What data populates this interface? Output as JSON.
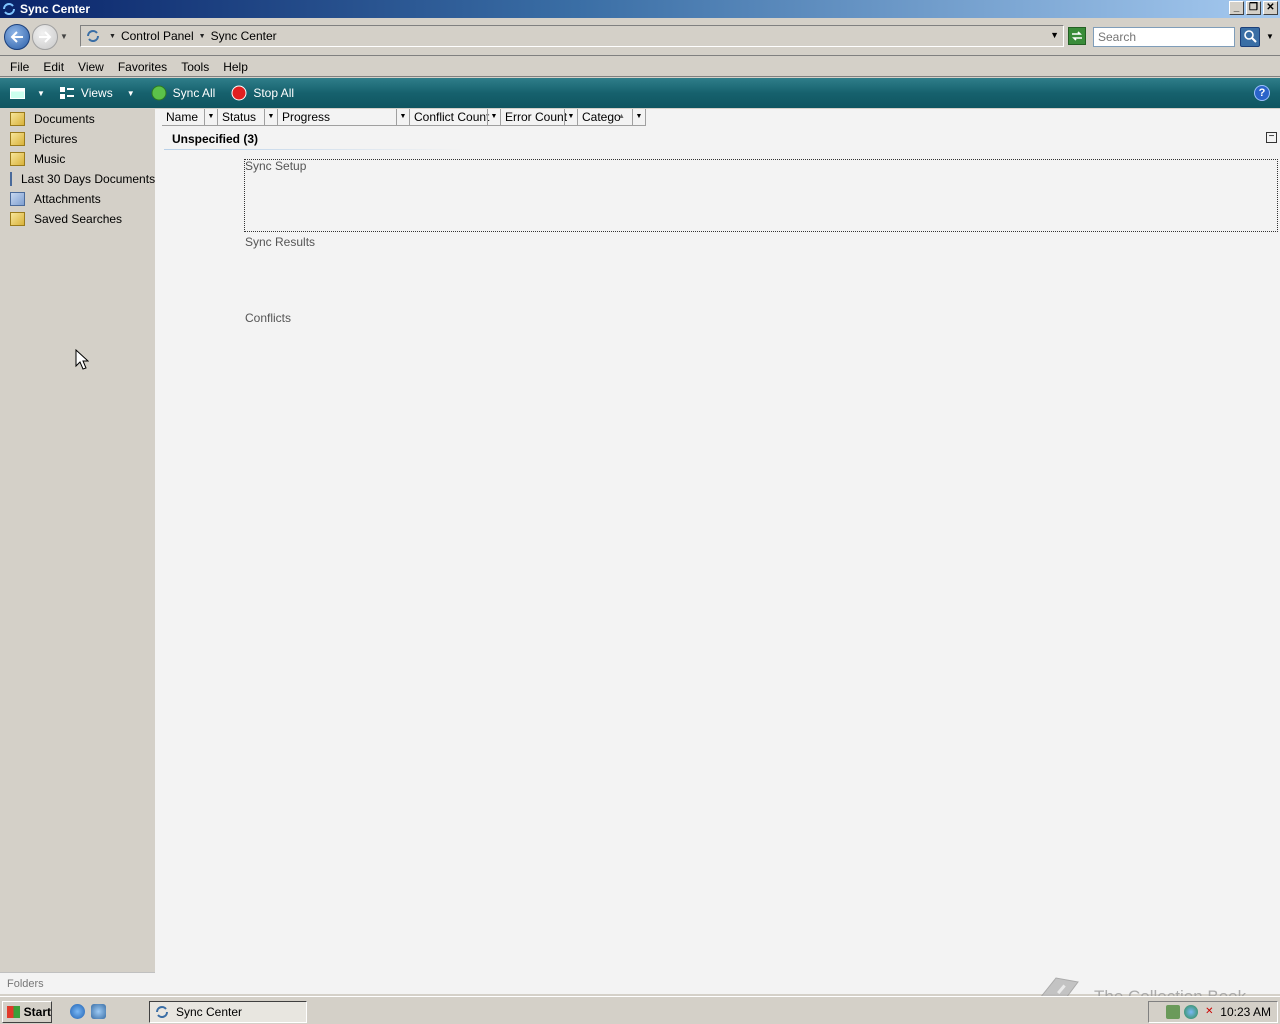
{
  "window": {
    "title": "Sync Center",
    "buttons": {
      "minimize": "_",
      "restore": "❐",
      "close": "✕"
    }
  },
  "address": {
    "crumbs": [
      "Control Panel",
      "Sync Center"
    ],
    "search_placeholder": "Search"
  },
  "menu": [
    "File",
    "Edit",
    "View",
    "Favorites",
    "Tools",
    "Help"
  ],
  "commands": {
    "views": "Views",
    "sync_all": "Sync All",
    "stop_all": "Stop All",
    "help": "?"
  },
  "nav": {
    "items": [
      {
        "label": "Documents",
        "icon": "folder-icon"
      },
      {
        "label": "Pictures",
        "icon": "folder-icon"
      },
      {
        "label": "Music",
        "icon": "folder-icon"
      },
      {
        "label": "Last 30 Days Documents",
        "icon": "search-folder-icon"
      },
      {
        "label": "Attachments",
        "icon": "search-folder-icon"
      },
      {
        "label": "Saved Searches",
        "icon": "folder-icon"
      }
    ],
    "folders_label": "Folders"
  },
  "columns": [
    "Name",
    "Status",
    "Progress",
    "Conflict Count",
    "Error Count",
    "Catego"
  ],
  "group": {
    "header": "Unspecified (3)",
    "items": [
      "Sync Setup",
      "Sync Results",
      "Conflicts"
    ]
  },
  "taskbar": {
    "start": "Start",
    "task": "Sync Center",
    "clock": "10:23 AM"
  },
  "watermark": "The Collection Book",
  "colors": {
    "command_bar": "#16616d",
    "title_bar": "#0a246a",
    "content_bg": "#f3f3f3"
  }
}
